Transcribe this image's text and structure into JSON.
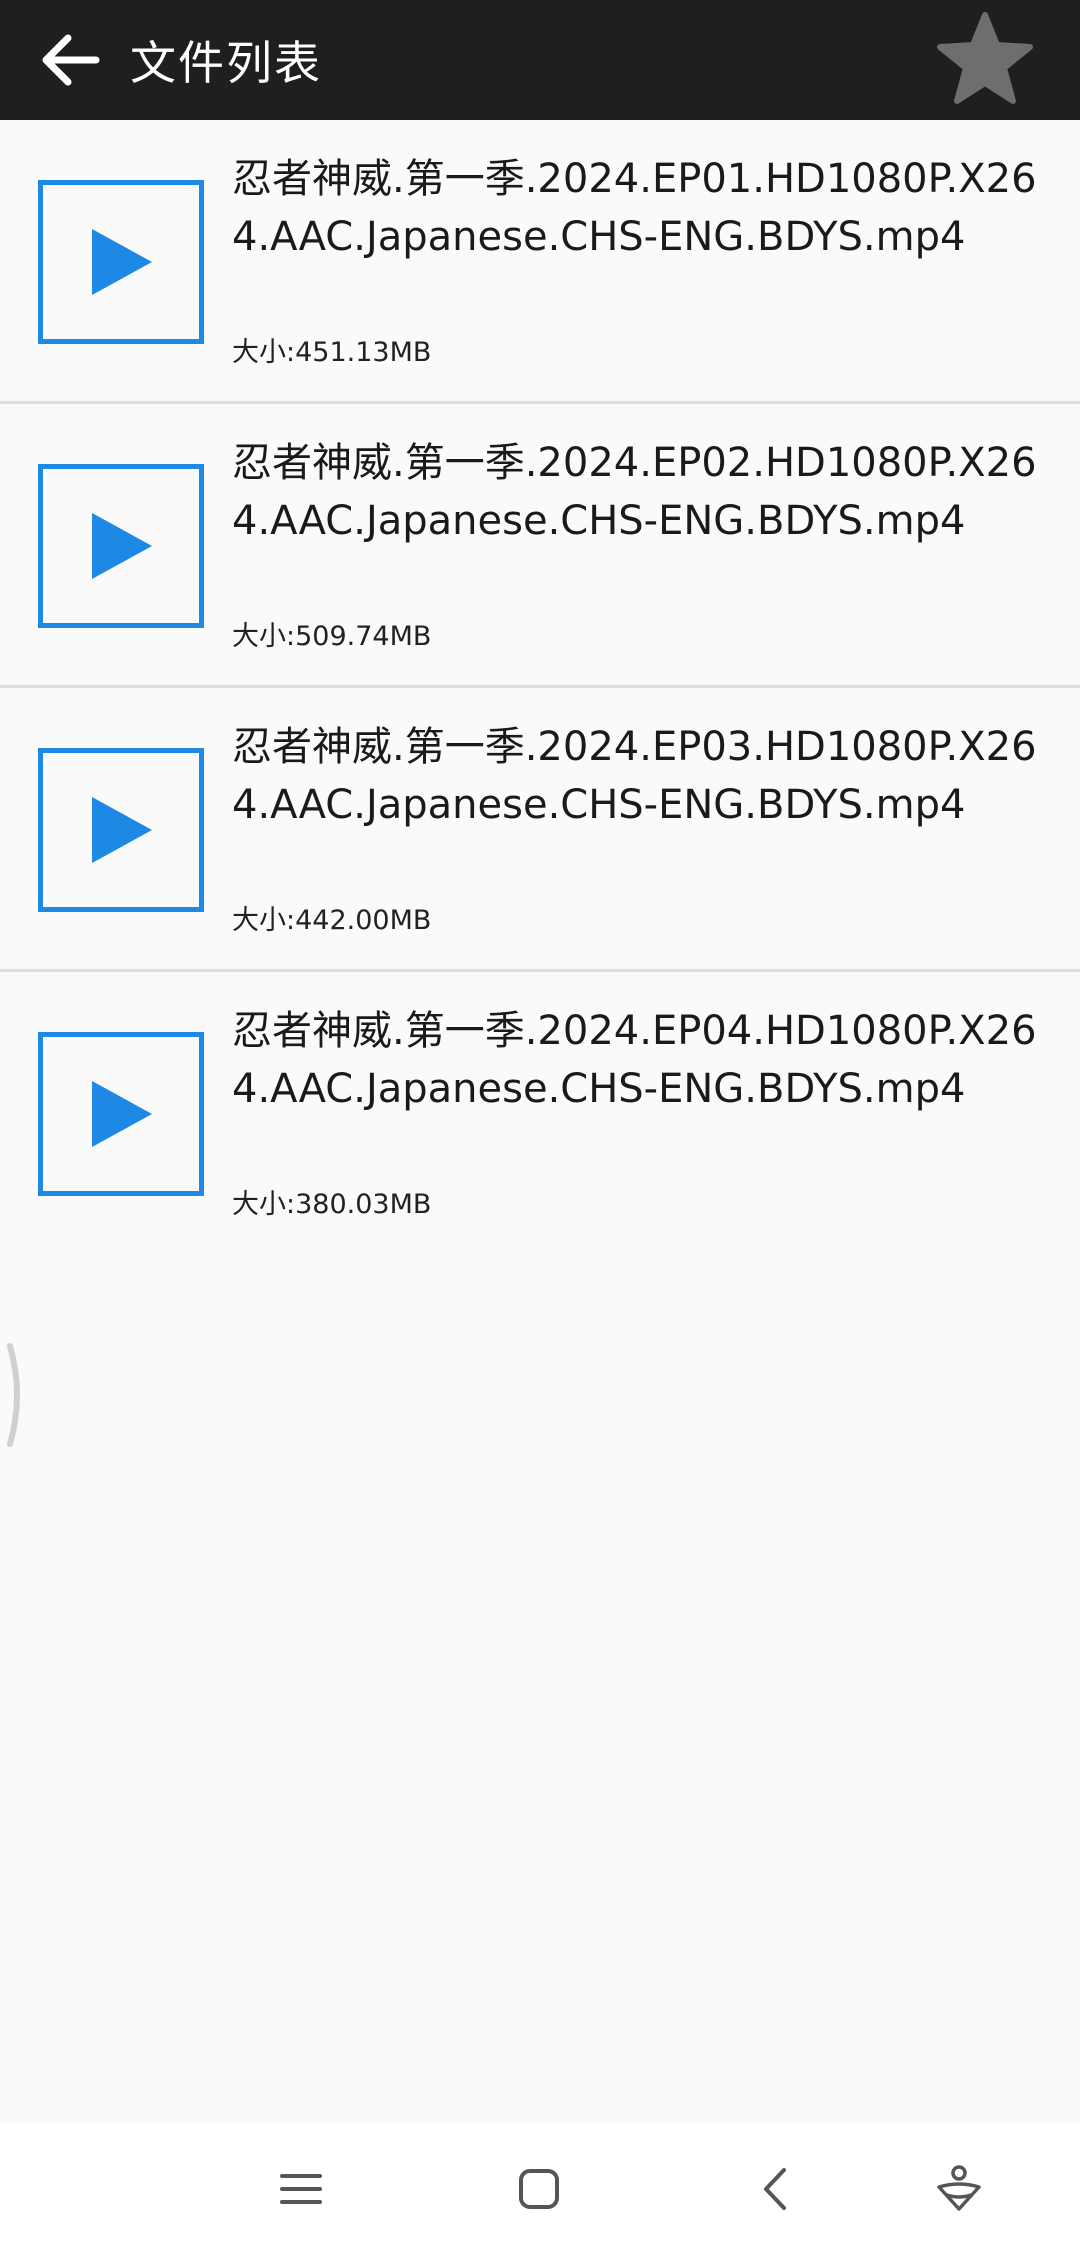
{
  "appbar": {
    "title": "文件列表",
    "back_icon": "arrow-left-icon",
    "star_icon": "star-icon",
    "background": "#1f1f1f",
    "star_color": "#6e6e6e"
  },
  "accent_color": "#1e88e5",
  "files": [
    {
      "name": "忍者神威.第一季.2024.EP01.HD1080P.X264.AAC.Japanese.CHS-ENG.BDYS.mp4",
      "size": "大小:451.13MB"
    },
    {
      "name": "忍者神威.第一季.2024.EP02.HD1080P.X264.AAC.Japanese.CHS-ENG.BDYS.mp4",
      "size": "大小:509.74MB"
    },
    {
      "name": "忍者神威.第一季.2024.EP03.HD1080P.X264.AAC.Japanese.CHS-ENG.BDYS.mp4",
      "size": "大小:442.00MB"
    },
    {
      "name": "忍者神威.第一季.2024.EP04.HD1080P.X264.AAC.Japanese.CHS-ENG.BDYS.mp4",
      "size": "大小:380.03MB"
    }
  ],
  "navbar": {
    "icons": [
      "menu-icon",
      "home-icon",
      "back-chevron-icon",
      "assistant-icon"
    ]
  }
}
